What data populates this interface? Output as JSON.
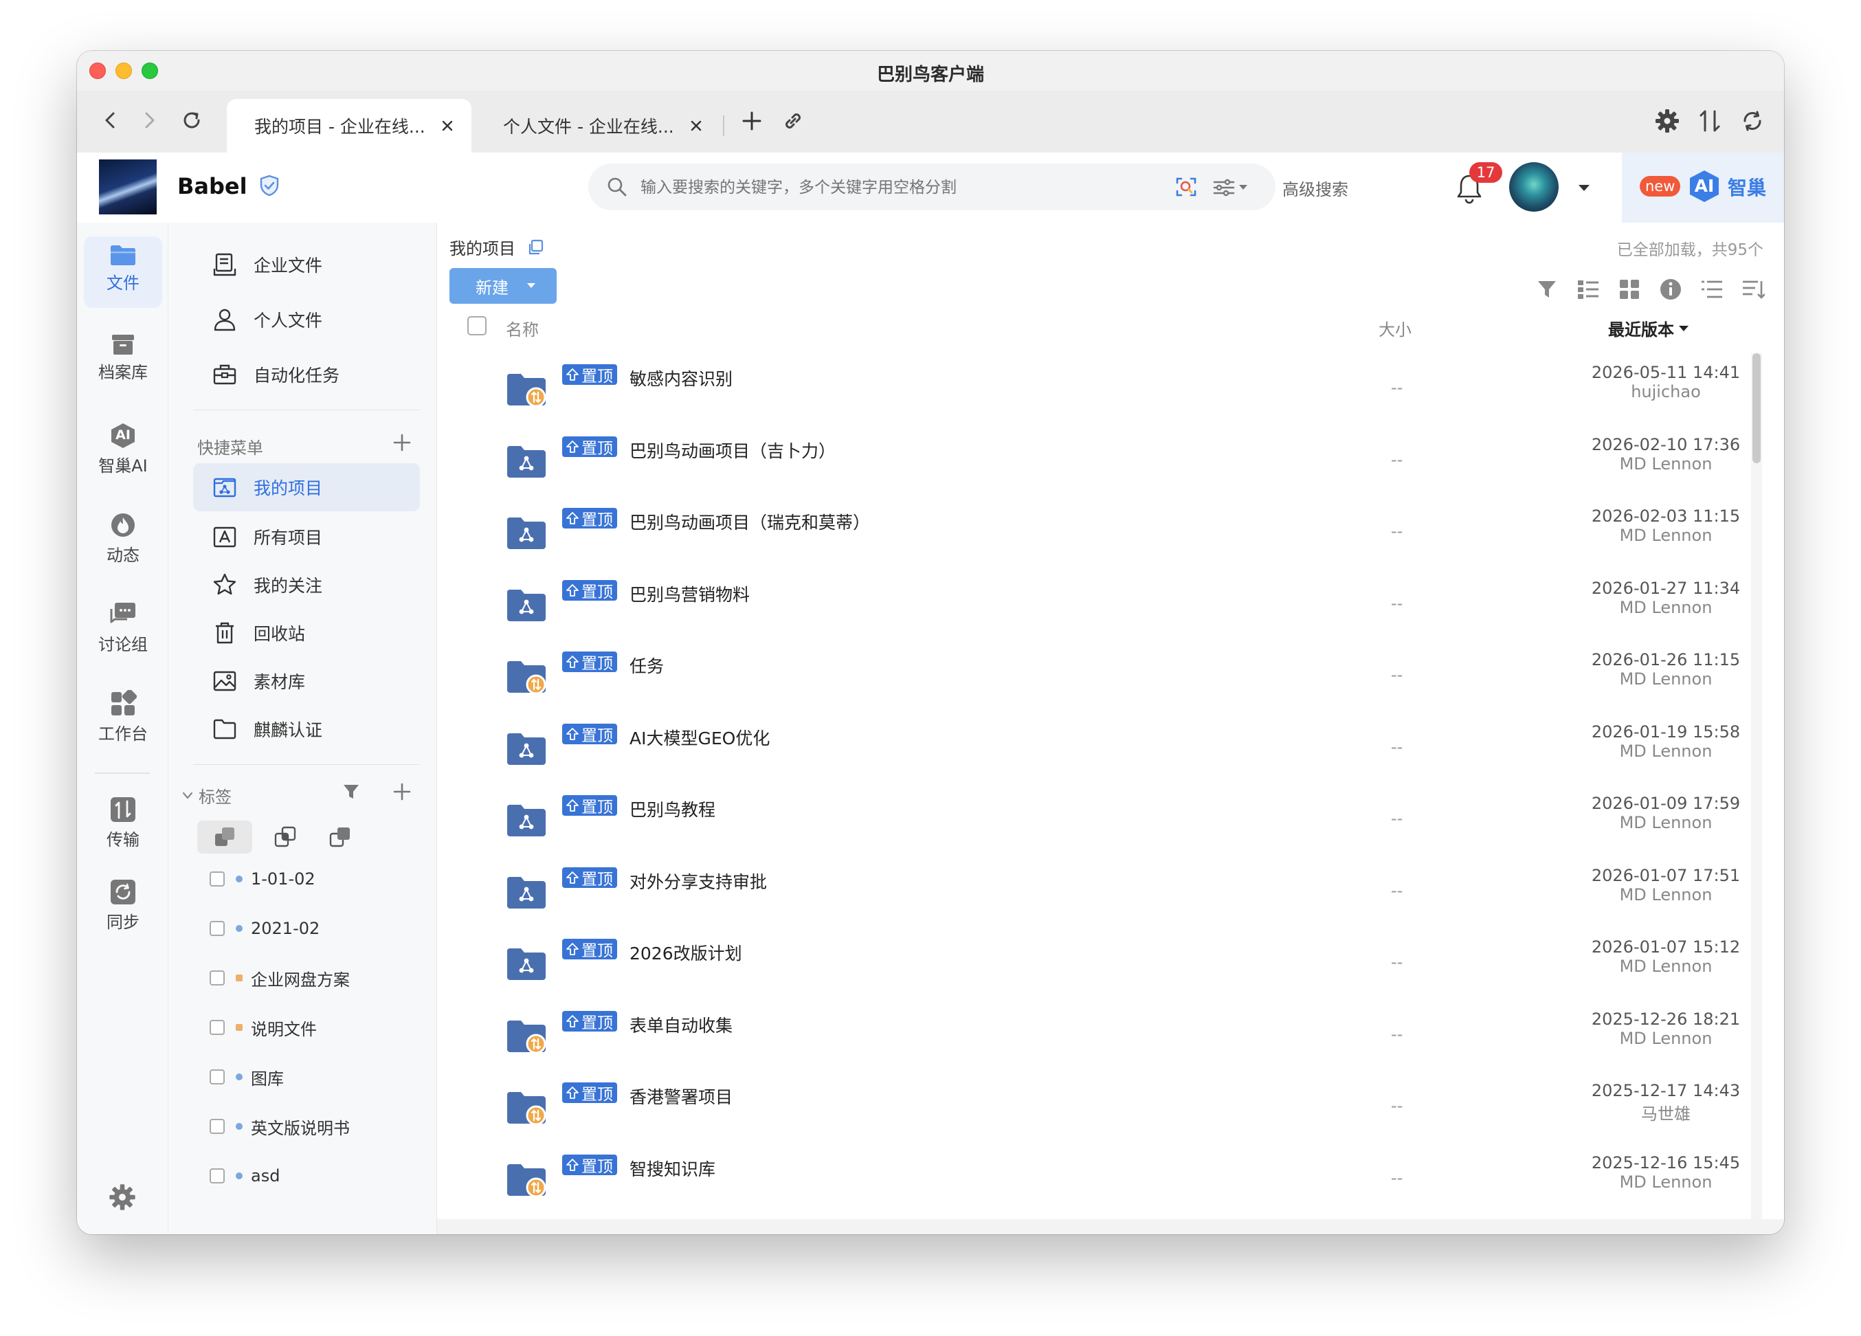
{
  "window": {
    "title": "巴别鸟客户端"
  },
  "tabs": [
    {
      "label": "我的项目 - 企业在线..."
    },
    {
      "label": "个人文件 - 企业在线..."
    }
  ],
  "brand": {
    "name": "Babel"
  },
  "search": {
    "placeholder": "输入要搜索的关键字，多个关键字用空格分割",
    "advanced_label": "高级搜索"
  },
  "notifications": {
    "count": "17"
  },
  "ai": {
    "new_badge": "new",
    "ai_label": "AI",
    "label": "智巢"
  },
  "sidebar": [
    {
      "label": "文件",
      "icon": "folder-icon"
    },
    {
      "label": "档案库",
      "icon": "archive-icon"
    },
    {
      "label": "智巢AI",
      "icon": "ai-hexagon-icon"
    },
    {
      "label": "动态",
      "icon": "flame-icon"
    },
    {
      "label": "讨论组",
      "icon": "chat-icon"
    },
    {
      "label": "工作台",
      "icon": "workbench-grid-icon"
    },
    {
      "label": "传输",
      "icon": "transfer-icon"
    },
    {
      "label": "同步",
      "icon": "sync-icon"
    }
  ],
  "nav": {
    "top": [
      {
        "label": "企业文件",
        "icon": "enterprise-icon"
      },
      {
        "label": "个人文件",
        "icon": "person-icon"
      },
      {
        "label": "自动化任务",
        "icon": "toolbox-icon"
      }
    ],
    "quick_title": "快捷菜单",
    "quick": [
      {
        "label": "我的项目",
        "icon": "project-icon"
      },
      {
        "label": "所有项目",
        "icon": "all-projects-icon"
      },
      {
        "label": "我的关注",
        "icon": "star-icon"
      },
      {
        "label": "回收站",
        "icon": "trash-icon"
      },
      {
        "label": "素材库",
        "icon": "image-icon"
      },
      {
        "label": "麒麟认证",
        "icon": "folder-outline-icon"
      }
    ],
    "tags_title": "标签",
    "tags": [
      {
        "label": "1-01-02",
        "color": "#7da7df"
      },
      {
        "label": "2021-02",
        "color": "#7da7df"
      },
      {
        "label": "企业网盘方案",
        "color": "#eeb06a"
      },
      {
        "label": "说明文件",
        "color": "#eeb06a"
      },
      {
        "label": "图库",
        "color": "#7da7df"
      },
      {
        "label": "英文版说明书",
        "color": "#7da7df"
      },
      {
        "label": "asd",
        "color": "#7da7df"
      }
    ]
  },
  "main": {
    "breadcrumb": "我的项目",
    "loaded_text": "已全部加载，共95个",
    "new_button": "新建",
    "columns": {
      "name": "名称",
      "size": "大小",
      "version": "最近版本"
    },
    "pin_label": "置顶",
    "rows": [
      {
        "name": "敏感内容识别",
        "size": "--",
        "date": "2026-05-11 14:41",
        "user": "hujichao",
        "icon": "folder-sync-icon"
      },
      {
        "name": "巴别鸟动画项目（吉卜力）",
        "size": "--",
        "date": "2026-02-10 17:36",
        "user": "MD Lennon",
        "icon": "folder-share-icon"
      },
      {
        "name": "巴别鸟动画项目（瑞克和莫蒂）",
        "size": "--",
        "date": "2026-02-03 11:15",
        "user": "MD Lennon",
        "icon": "folder-share-icon"
      },
      {
        "name": "巴别鸟营销物料",
        "size": "--",
        "date": "2026-01-27 11:34",
        "user": "MD Lennon",
        "icon": "folder-share-icon"
      },
      {
        "name": "任务",
        "size": "--",
        "date": "2026-01-26 11:15",
        "user": "MD Lennon",
        "icon": "folder-sync-icon"
      },
      {
        "name": "AI大模型GEO优化",
        "size": "--",
        "date": "2026-01-19 15:58",
        "user": "MD Lennon",
        "icon": "folder-share-icon"
      },
      {
        "name": "巴别鸟教程",
        "size": "--",
        "date": "2026-01-09 17:59",
        "user": "MD Lennon",
        "icon": "folder-share-icon"
      },
      {
        "name": "对外分享支持审批",
        "size": "--",
        "date": "2026-01-07 17:51",
        "user": "MD Lennon",
        "icon": "folder-share-icon"
      },
      {
        "name": "2026改版计划",
        "size": "--",
        "date": "2026-01-07 15:12",
        "user": "MD Lennon",
        "icon": "folder-share-icon"
      },
      {
        "name": "表单自动收集",
        "size": "--",
        "date": "2025-12-26 18:21",
        "user": "MD Lennon",
        "icon": "folder-sync-icon"
      },
      {
        "name": "香港警署项目",
        "size": "--",
        "date": "2025-12-17 14:43",
        "user": "马世雄",
        "icon": "folder-sync-icon"
      },
      {
        "name": "智搜知识库",
        "size": "--",
        "date": "2025-12-16 15:45",
        "user": "MD Lennon",
        "icon": "folder-sync-icon"
      }
    ]
  },
  "colors": {
    "accent": "#2f6fe0",
    "pin": "#3873d6",
    "folder": "#4a6fae",
    "sync_badge": "#f0a848",
    "badge_red": "#e5383b",
    "new_button": "#6aa5ea"
  }
}
